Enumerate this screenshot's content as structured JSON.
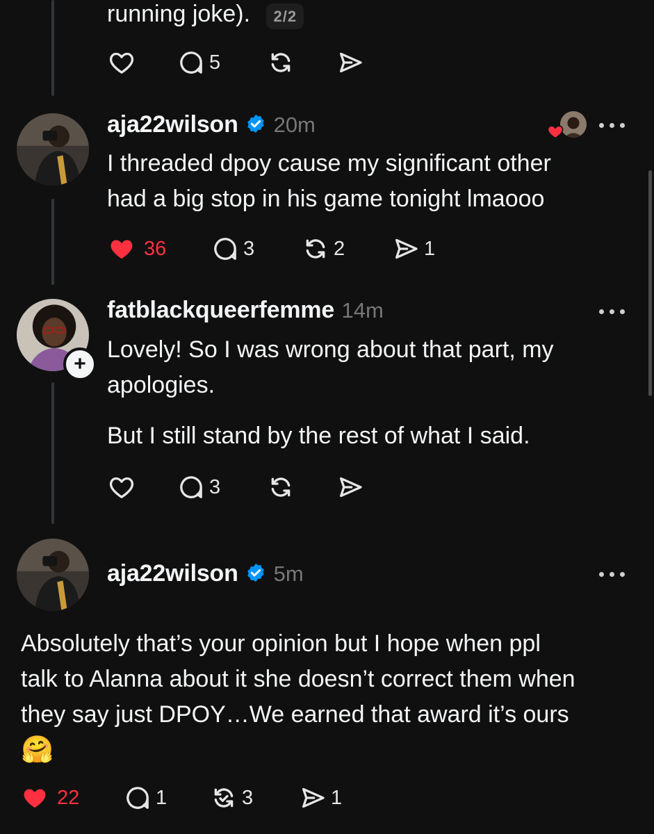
{
  "post0": {
    "text": "running joke).",
    "badge": "2/2",
    "reply_count": "5"
  },
  "post1": {
    "username": "aja22wilson",
    "time": "20m",
    "lines": [
      "I threaded dpoy cause my significant other",
      "had a big stop in his game tonight lmaooo"
    ],
    "like_count": "36",
    "reply_count": "3",
    "repost_count": "2",
    "share_count": "1"
  },
  "post2": {
    "username": "fatblackqueerfemme",
    "time": "14m",
    "lines": [
      "Lovely! So I was wrong about that part, my",
      "apologies."
    ],
    "line3": "But I still stand by the rest of what I said.",
    "reply_count": "3",
    "follow_icon": "+"
  },
  "post3": {
    "username": "aja22wilson",
    "time": "5m",
    "lines": [
      "Absolutely that’s your opinion but I hope when ppl",
      "talk to Alanna about it she doesn’t correct them when",
      "they say just DPOY…We earned that award it’s ours"
    ],
    "emoji": "🤗",
    "like_count": "22",
    "reply_count": "1",
    "repost_count": "3",
    "share_count": "1"
  },
  "colors": {
    "background": "#101010",
    "like_red": "#ff3040",
    "verified_blue": "#0095f6",
    "muted": "#777777"
  },
  "icons": [
    "heart-icon",
    "reply-icon",
    "repost-icon",
    "share-icon",
    "verified-icon",
    "more-icon"
  ]
}
